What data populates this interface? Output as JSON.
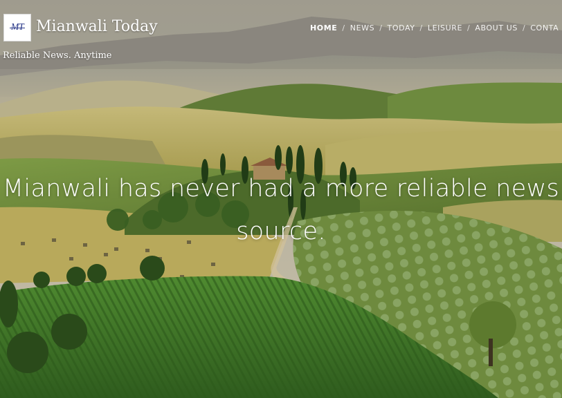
{
  "header": {
    "logo_monogram": "MT",
    "site_title": "Mianwali Today",
    "tagline": "Reliable News. Anytime"
  },
  "nav": {
    "items": [
      {
        "label": "HOME",
        "active": true
      },
      {
        "label": "NEWS",
        "active": false
      },
      {
        "label": "TODAY",
        "active": false
      },
      {
        "label": "LEISURE",
        "active": false
      },
      {
        "label": "ABOUT US",
        "active": false
      },
      {
        "label": "CONTA",
        "active": false
      }
    ],
    "separator": "/"
  },
  "hero": {
    "headline_line1": "Mianwali has never had a more reliable news",
    "headline_line2": "source."
  },
  "colors": {
    "sky": "#b9b3a2",
    "hills_far": "#8a8f86",
    "field_gold": "#c9b96a",
    "field_green": "#6f8f3a",
    "vineyard": "#3f7a2a",
    "text": "#ffffff",
    "logo_blue": "#2b3a8a"
  }
}
